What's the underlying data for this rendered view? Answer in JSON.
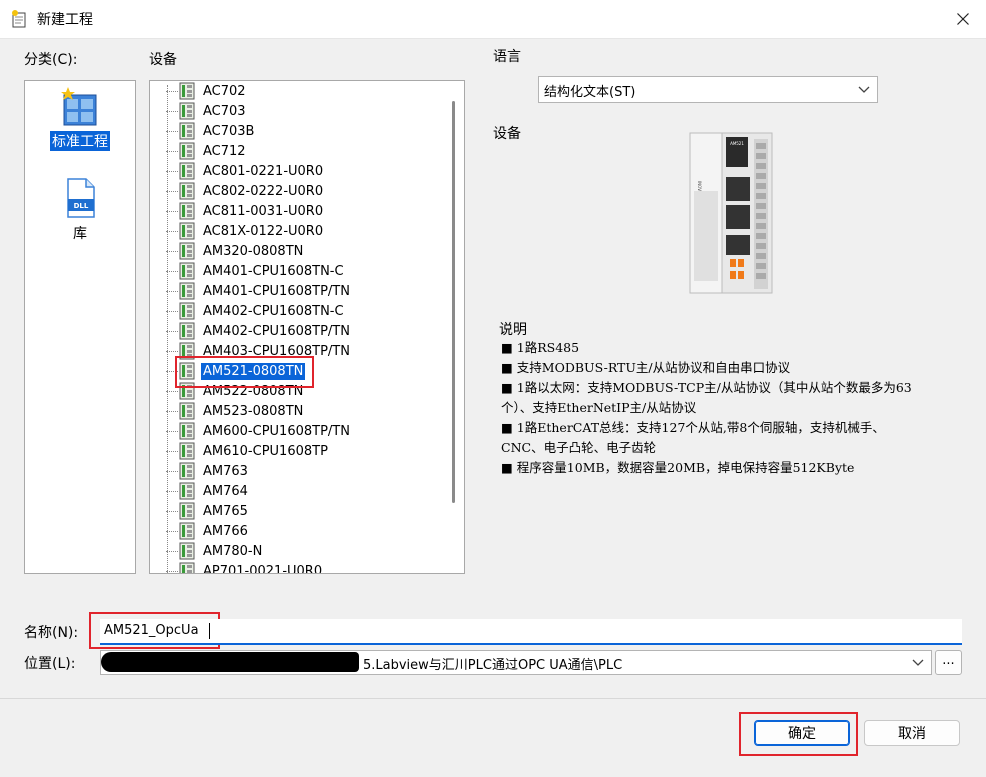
{
  "window": {
    "title": "新建工程"
  },
  "labels": {
    "category": "分类(C):",
    "device": "设备",
    "language": "语言",
    "device_preview": "设备",
    "description": "说明",
    "name": "名称(N):",
    "location": "位置(L):"
  },
  "categories": [
    {
      "label": "标准工程",
      "icon": "project-icon",
      "selected": true
    },
    {
      "label": "库",
      "icon": "dll-icon",
      "selected": false
    }
  ],
  "devices": [
    "AC702",
    "AC703",
    "AC703B",
    "AC712",
    "AC801-0221-U0R0",
    "AC802-0222-U0R0",
    "AC811-0031-U0R0",
    "AC81X-0122-U0R0",
    "AM320-0808TN",
    "AM401-CPU1608TN-C",
    "AM401-CPU1608TP/TN",
    "AM402-CPU1608TN-C",
    "AM402-CPU1608TP/TN",
    "AM403-CPU1608TP/TN",
    "AM521-0808TN",
    "AM522-0808TN",
    "AM523-0808TN",
    "AM600-CPU1608TP/TN",
    "AM610-CPU1608TP",
    "AM763",
    "AM764",
    "AM765",
    "AM766",
    "AM780-N",
    "AP701-0021-U0R0"
  ],
  "selected_device": "AM521-0808TN",
  "language": {
    "value": "结构化文本(ST)"
  },
  "device_brand": "INOVANCE",
  "device_model_label": "AM521",
  "description": [
    "■ 1路RS485",
    "■ 支持MODBUS-RTU主/从站协议和自由串口协议",
    "■ 1路以太网：支持MODBUS-TCP主/从站协议（其中从站个数最多为63",
    "个）、支持EtherNetIP主/从站协议",
    "■ 1路EtherCAT总线：支持127个从站,带8个伺服轴，支持机械手、",
    "CNC、电子凸轮、电子齿轮",
    "■ 程序容量10MB，数据容量20MB，掉电保持容量512KByte"
  ],
  "name_field": {
    "value": "AM521_OpcUa"
  },
  "location_field": {
    "value": "5.Labview与汇川PLC通过OPC UA通信\\PLC"
  },
  "buttons": {
    "browse": "...",
    "ok": "确定",
    "cancel": "取消"
  },
  "colors": {
    "accent": "#0a64d8",
    "highlight": "#e0242c"
  }
}
